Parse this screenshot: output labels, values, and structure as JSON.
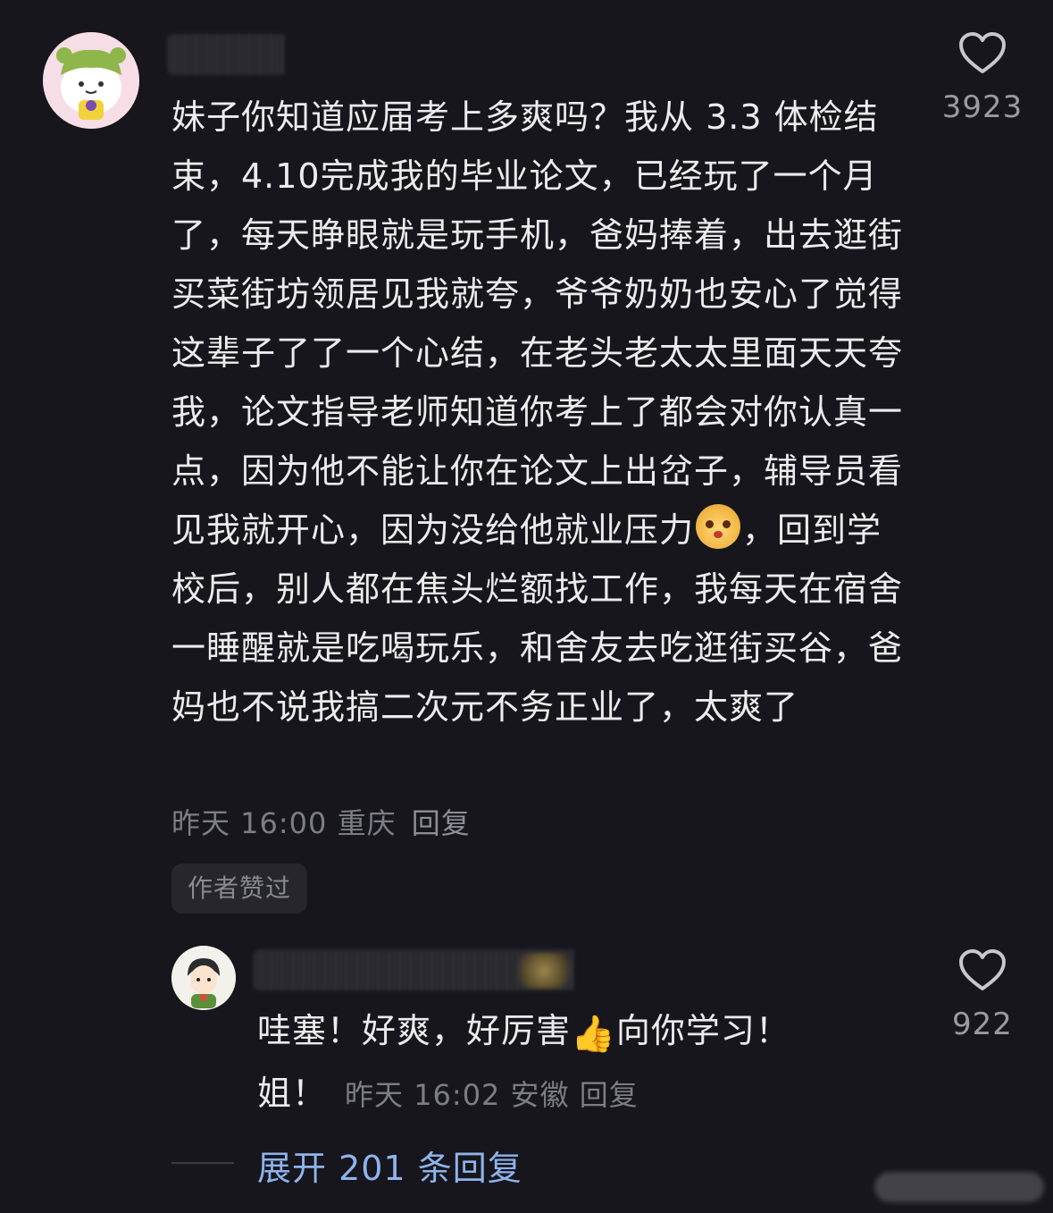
{
  "main_comment": {
    "text_before_emoji": "妹子你知道应届考上多爽吗？我从 3.3 体检结束，4.10完成我的毕业论文，已经玩了一个月了，每天睁眼就是玩手机，爸妈捧着，出去逛街买菜街坊领居见我就夸，爷爷奶奶也安心了觉得这辈子了了一个心结，在老头老太太里面天天夸我，论文指导老师知道你考上了都会对你认真一点，因为他不能让你在论文上出岔子，辅导员看见我就开心，因为没给他就业压力",
    "text_after_emoji": "，回到学校后，别人都在焦头烂额找工作，我每天在宿舍一睡醒就是吃喝玩乐，和舍友去吃逛街买谷，爸妈也不说我搞二次元不务正业了，太爽了",
    "time": "昨天 16:00",
    "location": "重庆",
    "reply_label": "回复",
    "author_liked_badge": "作者赞过",
    "like_count": "3923"
  },
  "reply_comment": {
    "text_part1": "哇塞！好爽，好厉害",
    "text_part2": "向你学习！姐！",
    "time": "昨天 16:02",
    "location": "安徽",
    "reply_label": "回复",
    "like_count": "922"
  },
  "expand_label": "展开 201 条回复"
}
